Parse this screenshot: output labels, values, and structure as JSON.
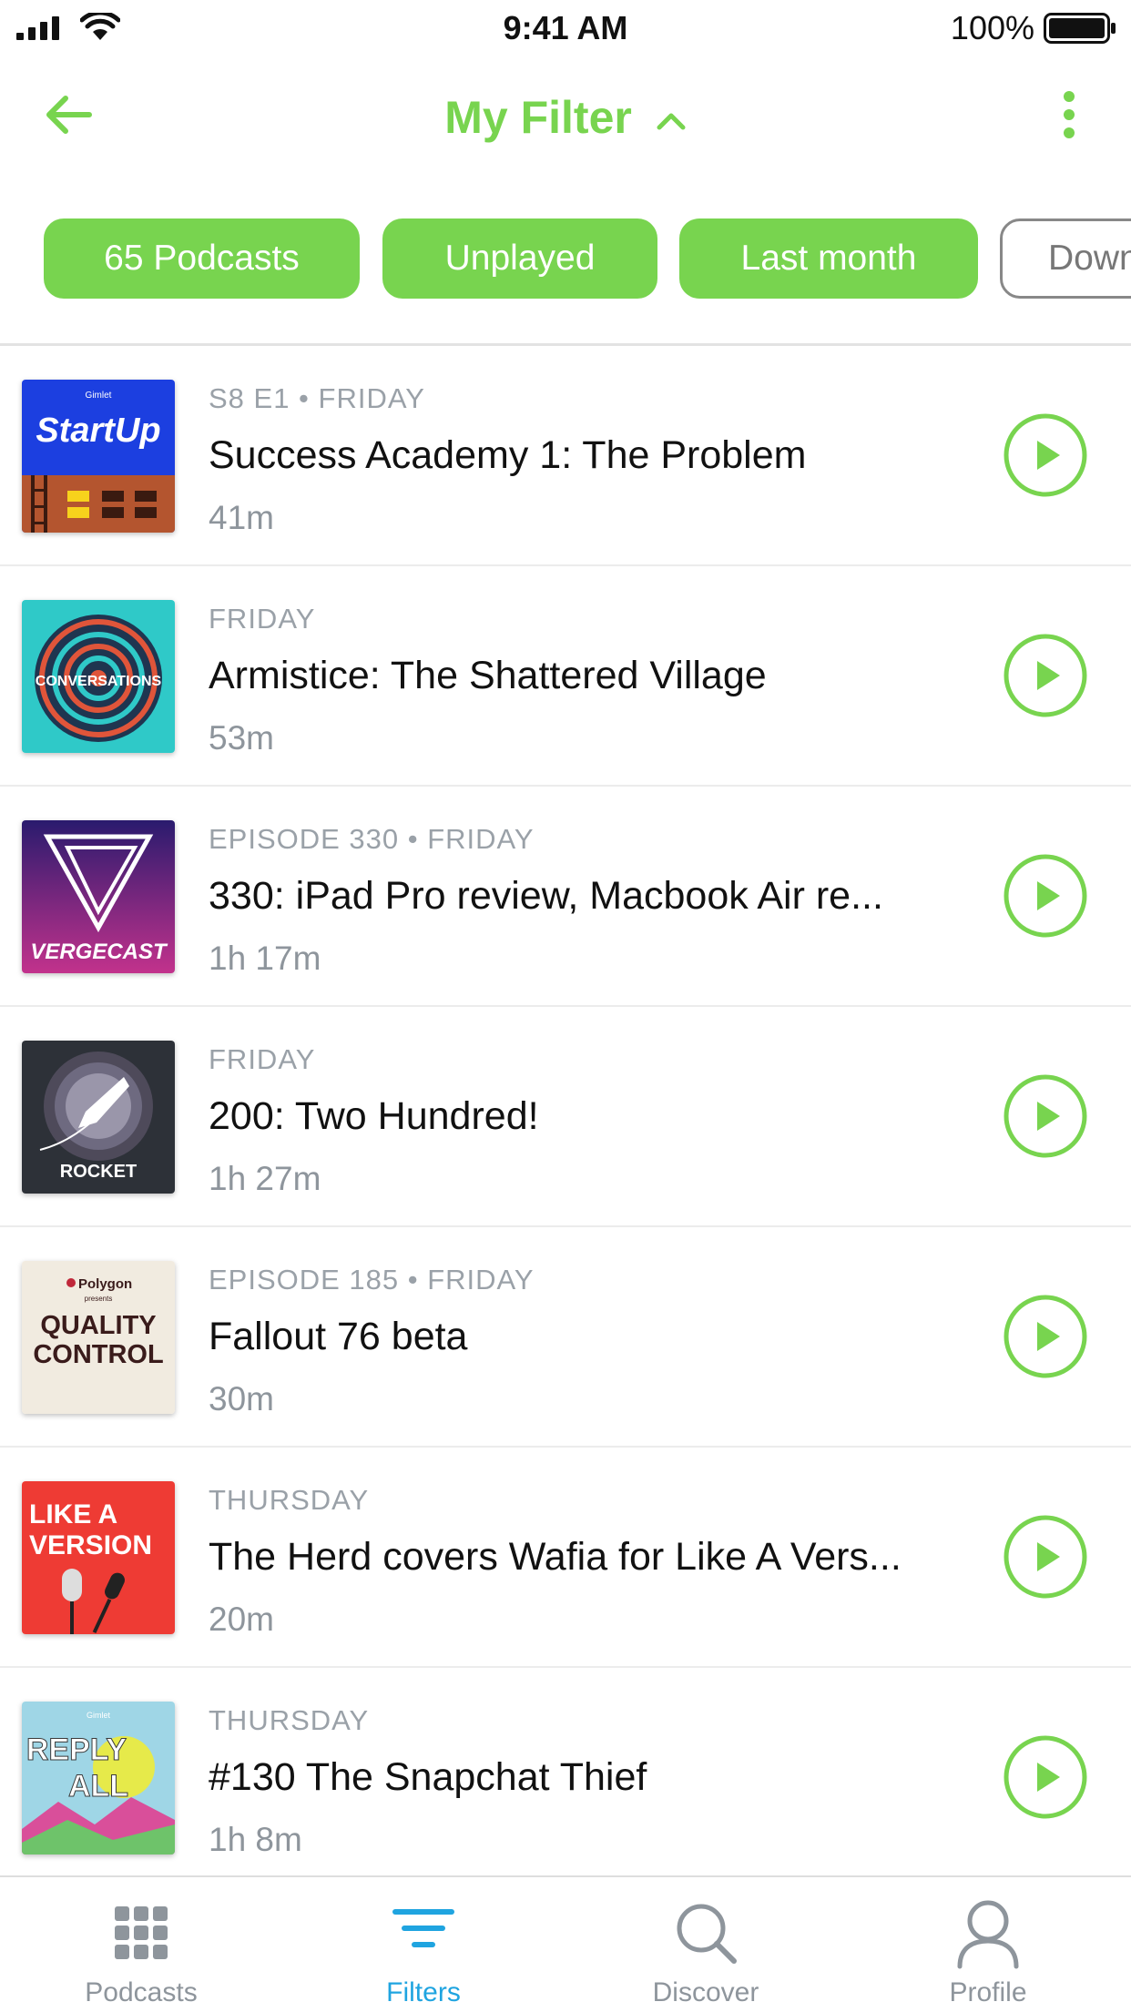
{
  "status_bar": {
    "time": "9:41 AM",
    "battery": "100%"
  },
  "header": {
    "title": "My Filter"
  },
  "chips": [
    {
      "label": "65 Podcasts"
    },
    {
      "label": "Unplayed"
    },
    {
      "label": "Last month"
    },
    {
      "label": "Down"
    }
  ],
  "episodes": [
    {
      "podcast_art": "StartUp",
      "meta": "S8 E1 • FRIDAY",
      "title": "Success Academy 1: The Problem",
      "duration": "41m"
    },
    {
      "podcast_art": "Conversations",
      "meta": "FRIDAY",
      "title": "Armistice: The Shattered Village",
      "duration": "53m"
    },
    {
      "podcast_art": "Vergecast",
      "meta": "EPISODE 330 • FRIDAY",
      "title": "330: iPad Pro review, Macbook Air re...",
      "duration": "1h 17m"
    },
    {
      "podcast_art": "Rocket",
      "meta": "FRIDAY",
      "title": "200: Two Hundred!",
      "duration": "1h 27m"
    },
    {
      "podcast_art": "Quality Control",
      "meta": "EPISODE 185 • FRIDAY",
      "title": "Fallout 76 beta",
      "duration": "30m"
    },
    {
      "podcast_art": "Like A Version",
      "meta": "THURSDAY",
      "title": "The Herd covers Wafia for Like A Vers...",
      "duration": "20m"
    },
    {
      "podcast_art": "Reply All",
      "meta": "THURSDAY",
      "title": "#130 The Snapchat Thief",
      "duration": "1h 8m"
    }
  ],
  "art_text": {
    "startup_brand": "Gimlet",
    "startup_name": "StartUp",
    "conversations": "CONVERSATIONS",
    "vergecast": "VERGECAST",
    "rocket": "ROCKET",
    "polygon": "Polygon",
    "polygon_presents": "presents",
    "qc_line1": "QUALITY",
    "qc_line2": "CONTROL",
    "lav_line1": "LIKE A",
    "lav_line2": "VERSION",
    "reply_brand": "Gimlet",
    "reply_line1": "REPLY",
    "reply_line2": "ALL"
  },
  "tabs": [
    {
      "label": "Podcasts",
      "icon": "grid-icon",
      "active": false
    },
    {
      "label": "Filters",
      "icon": "filter-icon",
      "active": true
    },
    {
      "label": "Discover",
      "icon": "search-icon",
      "active": false
    },
    {
      "label": "Profile",
      "icon": "profile-icon",
      "active": false
    }
  ],
  "colors": {
    "accent": "#78d44f",
    "tab_active": "#1fa4e0",
    "meta_text": "#9aa1a8"
  }
}
